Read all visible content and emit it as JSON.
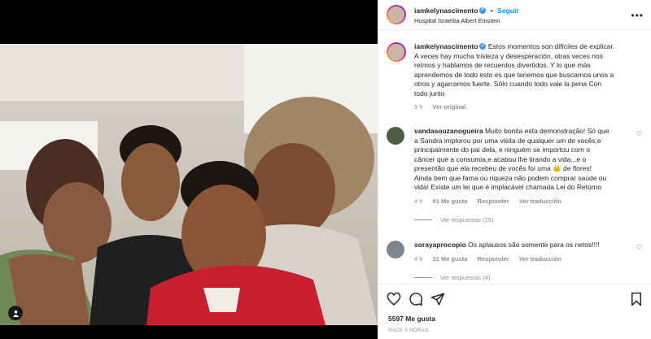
{
  "post": {
    "username": "iamkelynascimento",
    "follow_label": "Seguir",
    "location": "Hospital Israelita Albert Einstein",
    "caption_lines": [
      "Estos momentos son difíciles de explicar.",
      "A veces hay mucha tristeza y desesperación, otras veces nos",
      "reímos y hablamos de recuerdos divertidos. Y lo que más",
      "aprendemos de todo esto es que tenemos que buscarnos unos a",
      "otros y agarrarnos fuerte. Sólo cuando todo vale la pena Con",
      "todo junto"
    ],
    "caption_time": "5 h",
    "see_original": "Ver original"
  },
  "comments": [
    {
      "username": "vandasouzanogueira",
      "lines": [
        "Muito bonita esta demonstração! Só que",
        "a Sandra implorou por uma visita de qualquer um de vocês,e",
        "principalmente do pai dela, e ninguém se importou com o",
        "câncer que a consumia,e acabou lhe tirando a vida...e o",
        "presentão que ela recebeu de vocês foi uma 👑 de flores!",
        "Ainda bem que fama ou riqueza não podem comprar saúde ou",
        "vida! Existe um lei que é implacável chamada Lei do Retorno"
      ],
      "time": "4 h",
      "likes": "91 Me gusta",
      "reply": "Responder",
      "translate": "Ver traducción",
      "replies": "Ver respuestas (25)"
    },
    {
      "username": "sorayaprocopio",
      "lines": [
        "Os aplausos são somente para os netos!!!!"
      ],
      "time": "4 h",
      "likes": "31 Me gusta",
      "reply": "Responder",
      "translate": "Ver traducción",
      "replies": "Ver respuestas (4)"
    }
  ],
  "footer": {
    "likes": "5597 Me gusta",
    "time": "HACE 5 HORAS"
  },
  "icons": [
    "heart-icon",
    "comment-icon",
    "share-icon",
    "bookmark-icon",
    "more-options-icon",
    "verified-icon",
    "user-tag-icon"
  ],
  "colors": {
    "accent": "#0095f6",
    "verified": "#3897f0",
    "muted": "#8e8e8e",
    "text": "#262626"
  }
}
